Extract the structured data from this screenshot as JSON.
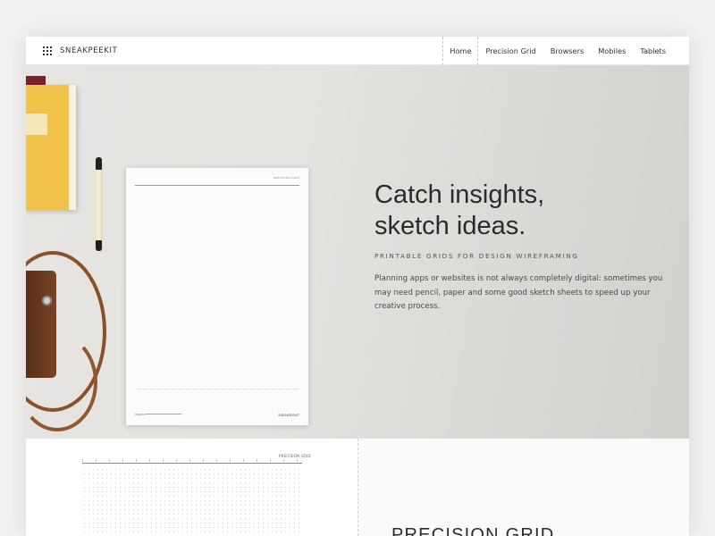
{
  "nav": {
    "brand": "SNEAKPEEKIT",
    "links": [
      "Home",
      "Precision Grid",
      "Browsers",
      "Mobiles",
      "Tablets"
    ],
    "active": "Home"
  },
  "hero": {
    "title_line1": "Catch insights,",
    "title_line2": "sketch ideas.",
    "subtitle": "PRINTABLE GRIDS FOR DESIGN WIREFRAMING",
    "description": "Planning apps or websites is not always completely digital: sometimes you may need pencil, paper and some good sketch sheets to speed up your creative process.",
    "paper": {
      "title": "PRECISION GRID",
      "project": "PROJECT",
      "brand": "SNEAKPEEKIT"
    }
  },
  "lower": {
    "grid_title": "PRECISION GRID",
    "section_title": "PRECISION GRID"
  },
  "colors": {
    "background": "#f1f1ef",
    "hero_bg": "#e4e3e0",
    "text": "#2b2b2b",
    "notebook": "#f1c24a",
    "leather": "#7a4425"
  }
}
